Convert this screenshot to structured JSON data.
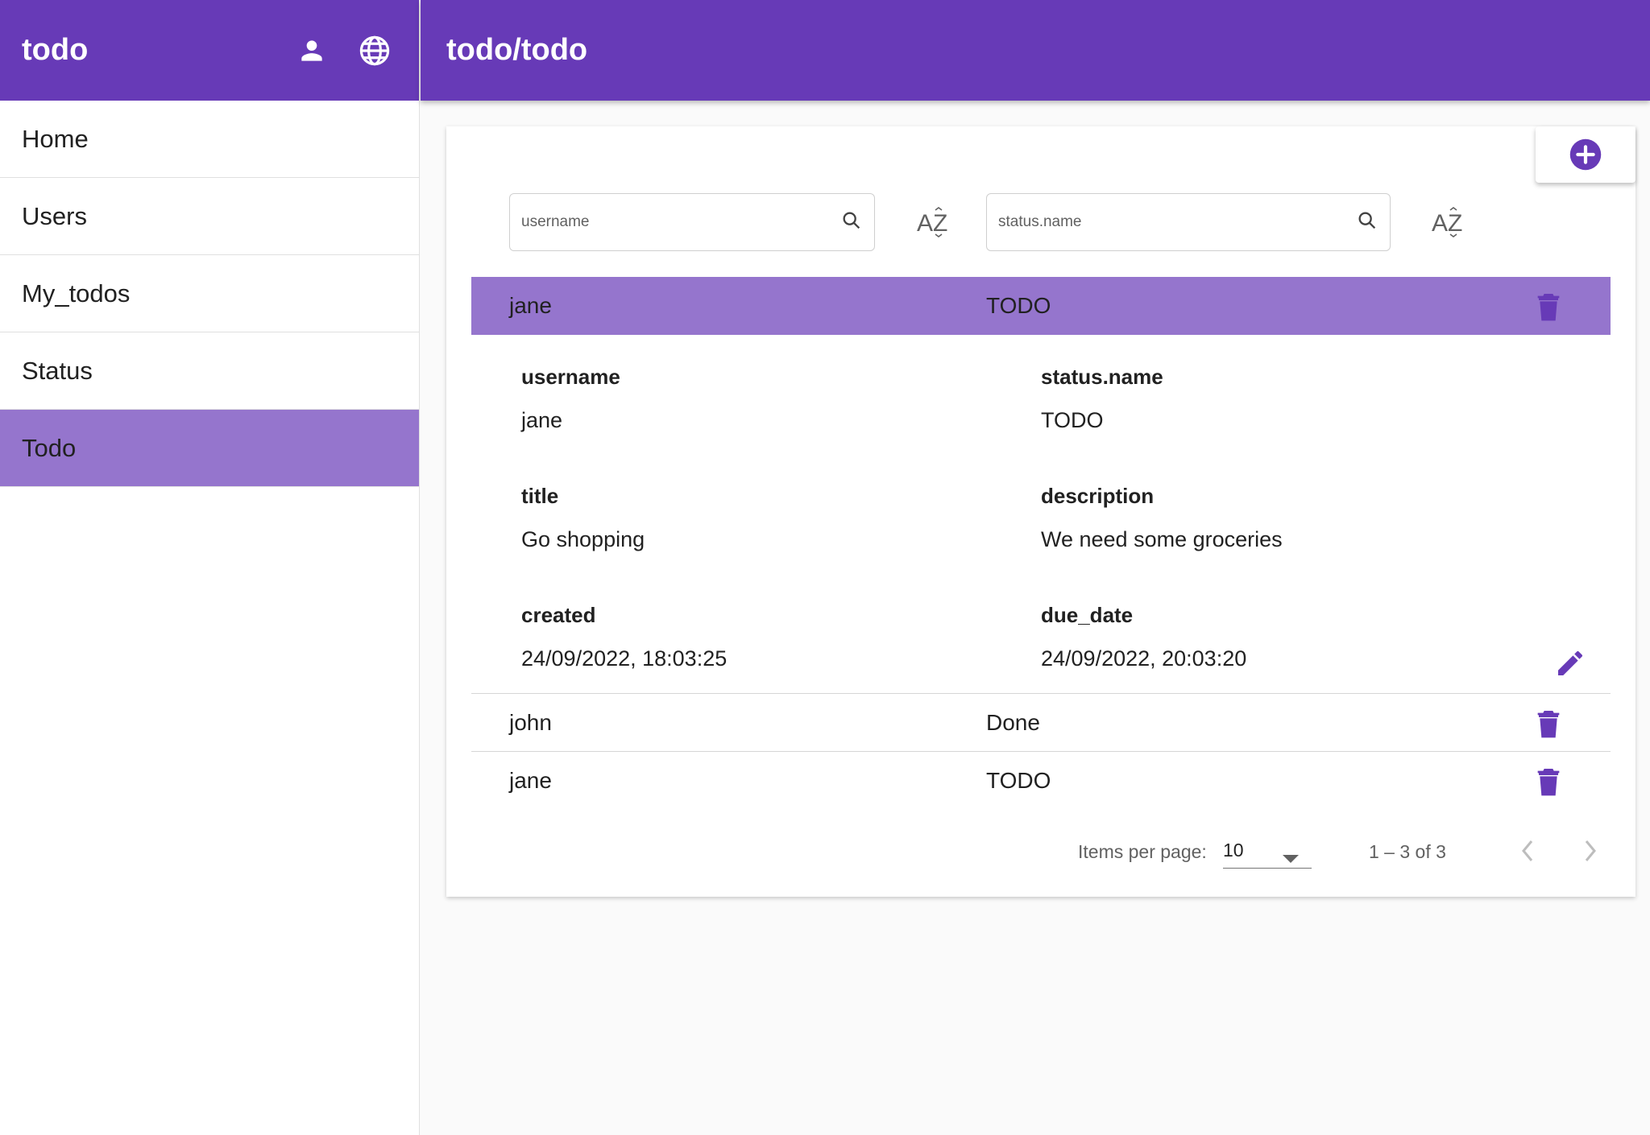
{
  "app": {
    "title": "todo",
    "page_title": "todo/todo"
  },
  "colors": {
    "primary": "#673ab7",
    "selected": "#9575cd",
    "icon": "#673ab7"
  },
  "header_icons": [
    "person-icon",
    "globe-icon"
  ],
  "nav": {
    "items": [
      {
        "label": "Home"
      },
      {
        "label": "Users"
      },
      {
        "label": "My_todos"
      },
      {
        "label": "Status"
      },
      {
        "label": "Todo",
        "active": true
      }
    ]
  },
  "filters": {
    "username_placeholder": "username",
    "status_placeholder": "status.name",
    "sort_label": "AZ"
  },
  "rows": [
    {
      "username": "jane",
      "status": "TODO",
      "selected": true
    },
    {
      "username": "john",
      "status": "Done"
    },
    {
      "username": "jane",
      "status": "TODO"
    }
  ],
  "detail": {
    "username_label": "username",
    "username_value": "jane",
    "status_label": "status.name",
    "status_value": "TODO",
    "title_label": "title",
    "title_value": "Go shopping",
    "description_label": "description",
    "description_value": "We need some groceries",
    "created_label": "created",
    "created_value": "24/09/2022, 18:03:25",
    "due_label": "due_date",
    "due_value": "24/09/2022, 20:03:20"
  },
  "paginator": {
    "items_per_page_label": "Items per page:",
    "page_size": "10",
    "range": "1 – 3 of 3"
  }
}
